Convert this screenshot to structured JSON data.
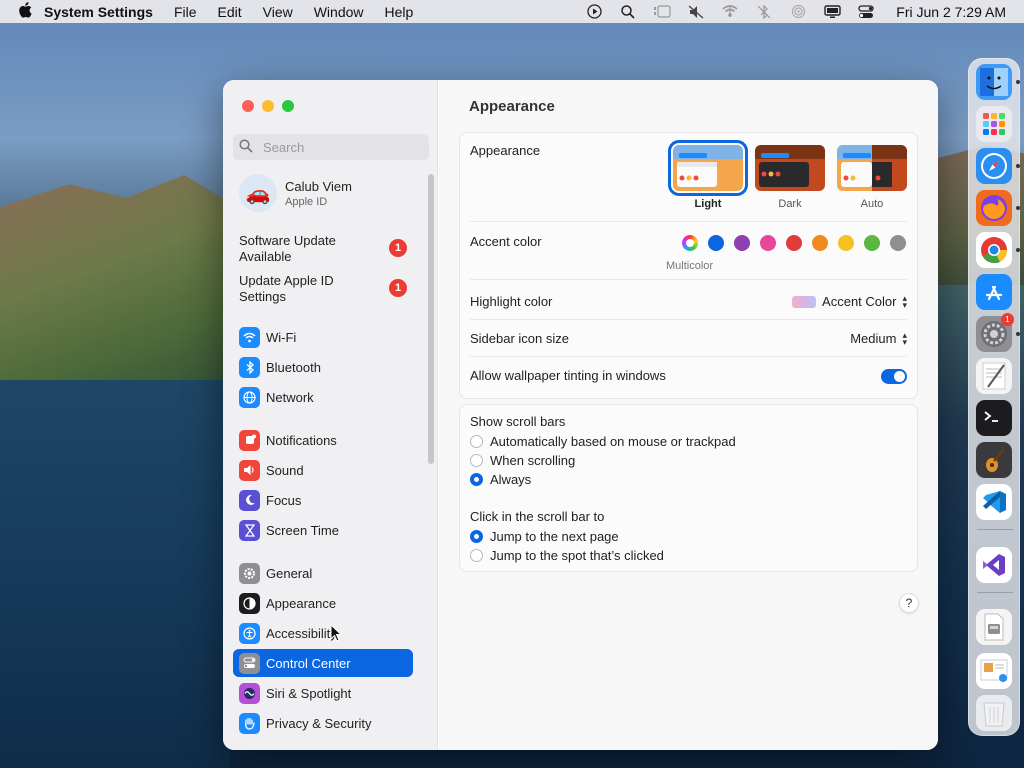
{
  "menubar": {
    "app_name": "System Settings",
    "items": [
      "File",
      "Edit",
      "View",
      "Window",
      "Help"
    ],
    "clock": "Fri Jun 2  7:29 AM"
  },
  "sidebar": {
    "search_placeholder": "Search",
    "account": {
      "name": "Calub Viem",
      "subtitle": "Apple ID"
    },
    "alerts": [
      {
        "label": "Software Update Available",
        "badge": "1"
      },
      {
        "label": "Update Apple ID Settings",
        "badge": "1"
      }
    ],
    "items": [
      {
        "label": "Wi-Fi",
        "icon": "wifi-icon",
        "color": "#1a8cff"
      },
      {
        "label": "Bluetooth",
        "icon": "bluetooth-icon",
        "color": "#1a8cff"
      },
      {
        "label": "Network",
        "icon": "globe-icon",
        "color": "#1a8cff"
      },
      {
        "label": "Notifications",
        "icon": "bell-icon",
        "color": "#f0453a"
      },
      {
        "label": "Sound",
        "icon": "speaker-icon",
        "color": "#f0453a"
      },
      {
        "label": "Focus",
        "icon": "moon-icon",
        "color": "#5b4fd6"
      },
      {
        "label": "Screen Time",
        "icon": "hourglass-icon",
        "color": "#5b4fd6"
      },
      {
        "label": "General",
        "icon": "gear-icon",
        "color": "#8e8e93"
      },
      {
        "label": "Appearance",
        "icon": "appearance-icon",
        "color": "#1c1c1e"
      },
      {
        "label": "Accessibility",
        "icon": "accessibility-icon",
        "color": "#1a8cff"
      },
      {
        "label": "Control Center",
        "icon": "control-center-icon",
        "color": "#8e8e93",
        "selected": true
      },
      {
        "label": "Siri & Spotlight",
        "icon": "siri-icon",
        "color": "#b44fd6"
      },
      {
        "label": "Privacy & Security",
        "icon": "hand-icon",
        "color": "#1a8cff"
      }
    ]
  },
  "main": {
    "title": "Appearance",
    "appearance": {
      "label": "Appearance",
      "options": [
        {
          "caption": "Light",
          "selected": true
        },
        {
          "caption": "Dark",
          "selected": false
        },
        {
          "caption": "Auto",
          "selected": false
        }
      ]
    },
    "accent": {
      "label": "Accent color",
      "caption": "Multicolor",
      "colors": [
        "#0a67e0",
        "#8e3fb0",
        "#e8479b",
        "#e23b3b",
        "#f18a1c",
        "#f6c125",
        "#5cb740",
        "#8e8e93"
      ]
    },
    "highlight": {
      "label": "Highlight color",
      "value": "Accent Color"
    },
    "sidebar_icon_size": {
      "label": "Sidebar icon size",
      "value": "Medium"
    },
    "wallpaper_tinting": {
      "label": "Allow wallpaper tinting in windows",
      "on": true
    },
    "scroll_bars": {
      "label": "Show scroll bars",
      "options": [
        {
          "label": "Automatically based on mouse or trackpad",
          "selected": false
        },
        {
          "label": "When scrolling",
          "selected": false
        },
        {
          "label": "Always",
          "selected": true
        }
      ]
    },
    "click_scroll": {
      "label": "Click in the scroll bar to",
      "options": [
        {
          "label": "Jump to the next page",
          "selected": true
        },
        {
          "label": "Jump to the spot that’s clicked",
          "selected": false
        }
      ]
    },
    "help_label": "?"
  },
  "dock": {
    "apps": [
      {
        "name": "finder-icon",
        "color": "#3e9bf5"
      },
      {
        "name": "launchpad-icon",
        "color": "#e9e9ee"
      },
      {
        "name": "safari-icon",
        "color": "#2a8ff0"
      },
      {
        "name": "firefox-icon",
        "color": "#f06b1e"
      },
      {
        "name": "chrome-icon",
        "color": "#ffffff"
      },
      {
        "name": "app-store-icon",
        "color": "#1a8cff"
      },
      {
        "name": "system-settings-icon",
        "color": "#8e8e93",
        "badge": "1"
      },
      {
        "name": "textedit-icon",
        "color": "#f4f4f4"
      },
      {
        "name": "terminal-icon",
        "color": "#1c1c1e"
      },
      {
        "name": "garageband-icon",
        "color": "#3a3a3c"
      },
      {
        "name": "vscode-icon",
        "color": "#ffffff"
      },
      {
        "name": "visual-studio-icon",
        "color": "#ffffff"
      },
      {
        "name": "disk-image-icon",
        "color": "#f4f4f4"
      },
      {
        "name": "preview-icon",
        "color": "#ffffff"
      },
      {
        "name": "trash-icon",
        "color": "#e9ecef"
      }
    ]
  }
}
